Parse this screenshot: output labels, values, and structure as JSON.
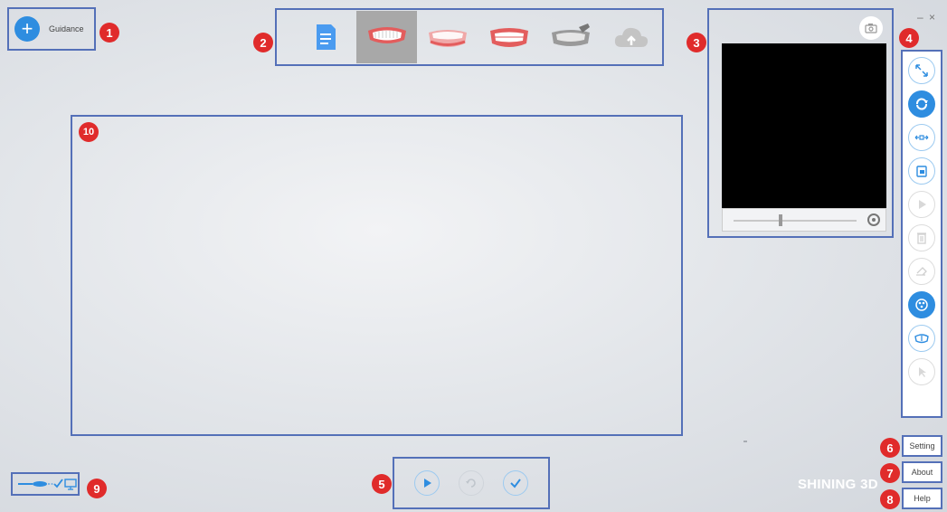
{
  "guidance": {
    "label": "Guidance",
    "badge": "1"
  },
  "toolbar": {
    "badge": "2",
    "items": [
      {
        "name": "order-notes-icon"
      },
      {
        "name": "upper-jaw-icon",
        "active": true
      },
      {
        "name": "lower-jaw-icon"
      },
      {
        "name": "occlusion-icon"
      },
      {
        "name": "edit-model-icon"
      },
      {
        "name": "cloud-upload-icon"
      }
    ]
  },
  "camera_panel": {
    "badge": "3",
    "snapshot_icon": "camera-icon"
  },
  "window_controls": {
    "minimize": "–",
    "close": "×"
  },
  "sidebar": {
    "badge": "4",
    "tools": [
      "fit-view-icon",
      "rotate-icon",
      "pan-icon",
      "lock-icon",
      "play-icon",
      "delete-icon",
      "eraser-icon",
      "texture-icon",
      "jaw-view-icon",
      "select-icon"
    ]
  },
  "bottom_controls": {
    "badge": "5"
  },
  "buttons": {
    "setting": {
      "label": "Setting",
      "badge": "6"
    },
    "about": {
      "label": "About",
      "badge": "7"
    },
    "help": {
      "label": "Help",
      "badge": "8"
    }
  },
  "status": {
    "badge": "9"
  },
  "main_view": {
    "badge": "10"
  },
  "brand": "SHINING 3D",
  "colors": {
    "accent": "#2e8de0",
    "annotation_border": "#5470b8",
    "badge": "#e02b2b"
  }
}
